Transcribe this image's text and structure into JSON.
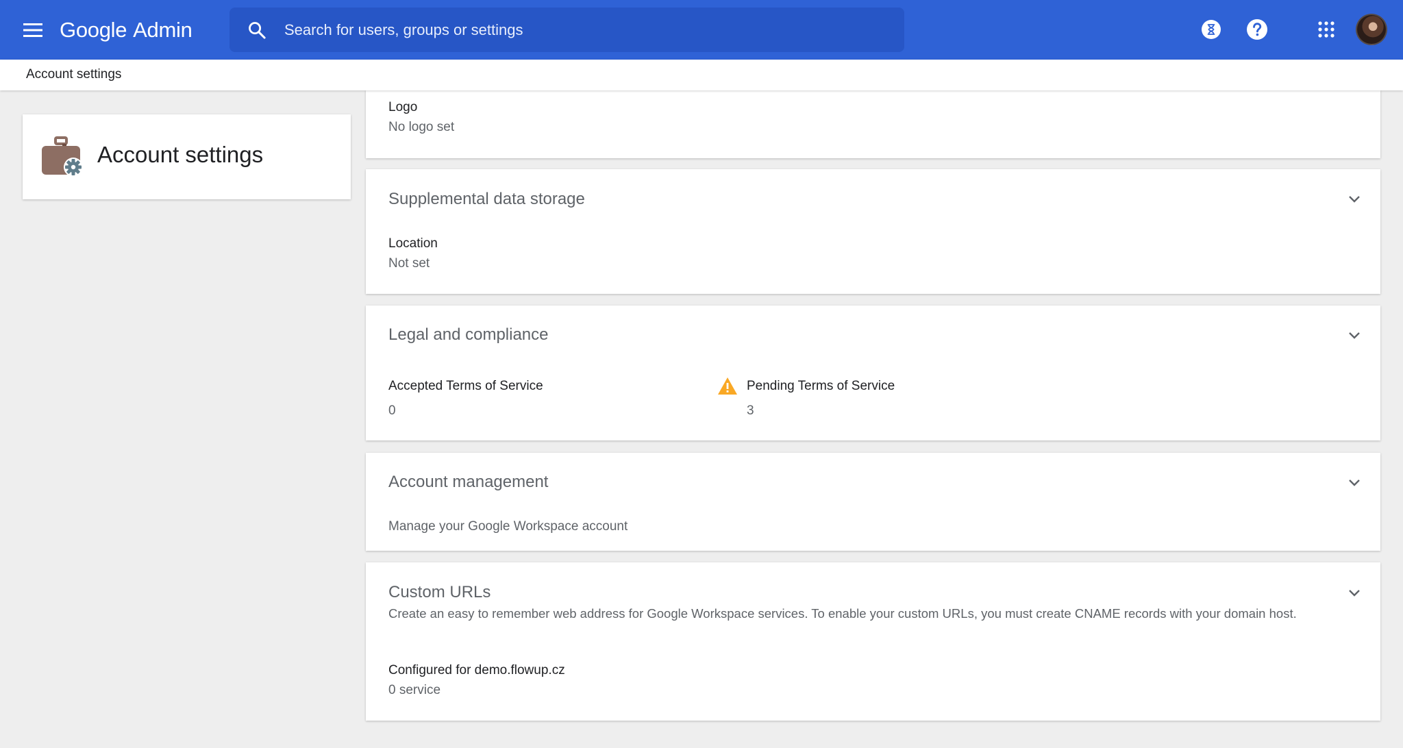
{
  "header": {
    "brand_google": "Google",
    "brand_admin": "Admin",
    "search_placeholder": "Search for users, groups or settings",
    "colors": {
      "bar": "#2f62d6",
      "search": "#2756c6"
    },
    "icons": [
      "menu-icon",
      "search-icon",
      "hourglass-icon",
      "help-icon",
      "apps-grid-icon"
    ]
  },
  "breadcrumb": {
    "current": "Account settings"
  },
  "sidebar_card": {
    "title": "Account settings",
    "icon": "briefcase-gear-icon"
  },
  "cards": {
    "logo": {
      "label": "Logo",
      "value": "No logo set"
    },
    "storage": {
      "title": "Supplemental data storage",
      "label": "Location",
      "value": "Not set"
    },
    "legal": {
      "title": "Legal and compliance",
      "accepted_label": "Accepted Terms of Service",
      "accepted_value": "0",
      "pending_label": "Pending Terms of Service",
      "pending_value": "3",
      "warning_color": "#f9a825"
    },
    "account": {
      "title": "Account management",
      "description": "Manage your Google Workspace account"
    },
    "urls": {
      "title": "Custom URLs",
      "description": "Create an easy to remember web address for Google Workspace services. To enable your custom URLs, you must create CNAME records with your domain host.",
      "label": "Configured for demo.flowup.cz",
      "value": "0 service"
    }
  }
}
